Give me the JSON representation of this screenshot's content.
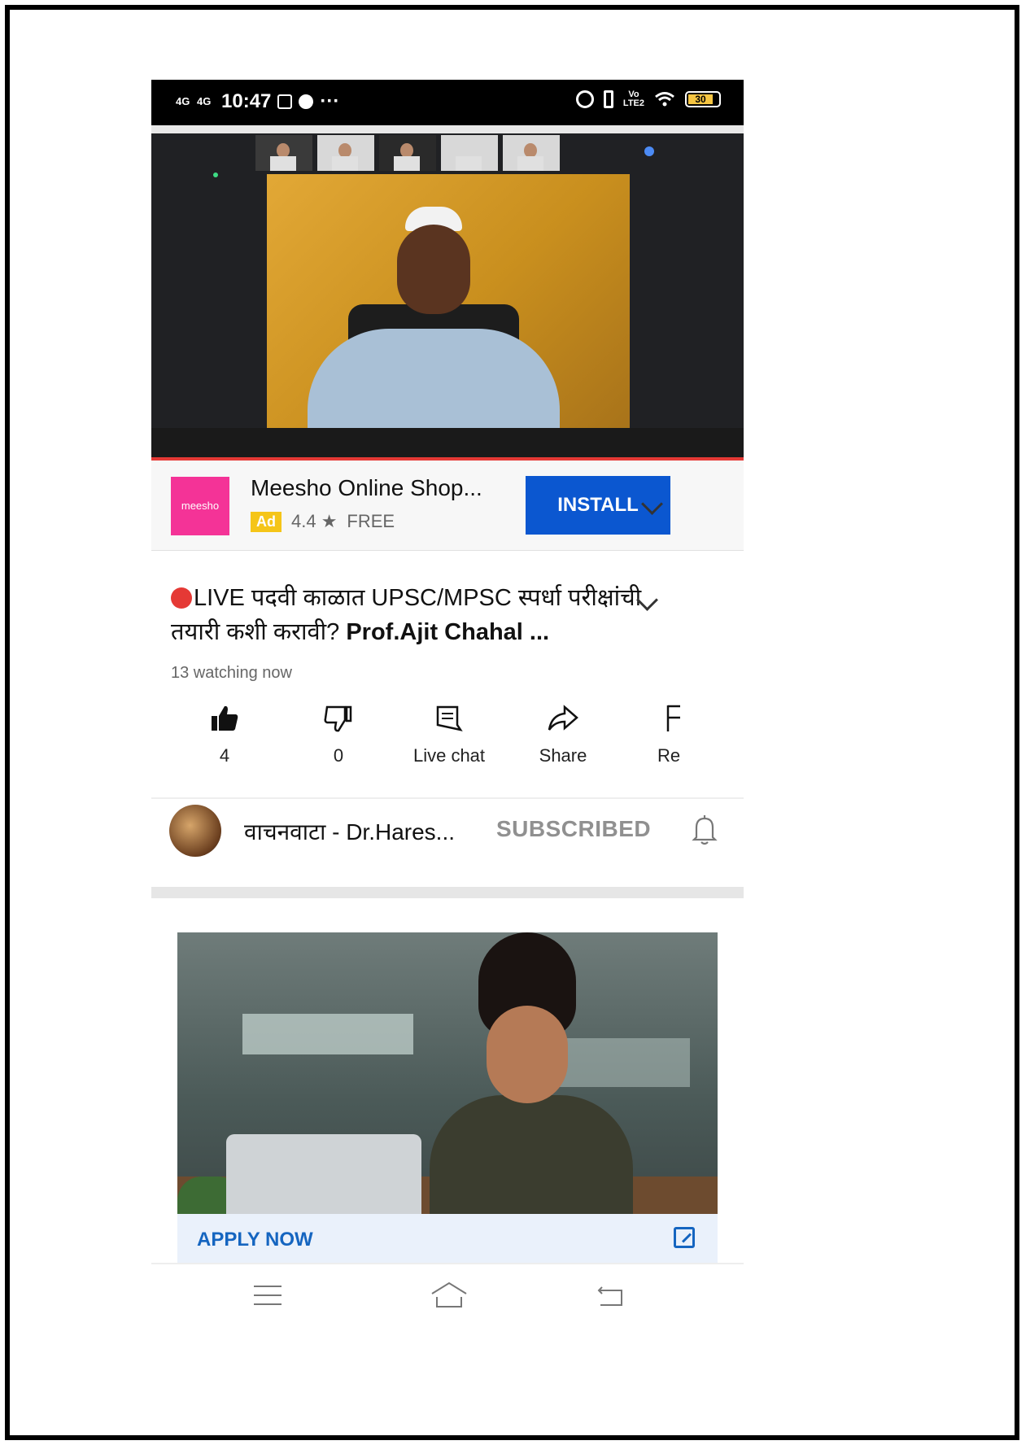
{
  "status_bar": {
    "time": "10:47",
    "net1": "4G",
    "net2": "4G",
    "volte_top": "Vo",
    "volte_bottom": "LTE2",
    "more": "···",
    "battery": "30"
  },
  "video": {
    "host_label": ""
  },
  "ad": {
    "logo_text": "meesho",
    "title": "Meesho Online Shop...",
    "badge": "Ad",
    "rating": "4.4 ★",
    "price": "FREE",
    "install_label": "INSTALL"
  },
  "video_info": {
    "title_part1": "LIVE पदवी काळात UPSC/MPSC स्पर्धा परीक्षांची तयारी कशी करावी? ",
    "title_part2": "Prof.Ajit Chahal ...",
    "watching": "13 watching now"
  },
  "actions": {
    "like_count": "4",
    "dislike_count": "0",
    "live_chat": "Live chat",
    "share": "Share",
    "report": "Re"
  },
  "channel": {
    "name": "वाचनवाटा - Dr.Hares...",
    "subscribed": "SUBSCRIBED"
  },
  "promo": {
    "apply_label": "APPLY NOW"
  },
  "colors": {
    "install_blue": "#0b57d0",
    "meesho_pink": "#f43397",
    "live_red": "#e53935",
    "apply_blue": "#1565c0"
  },
  "icons": [
    "signal-icon",
    "alarm-icon",
    "vibrate-icon",
    "wifi-icon",
    "battery-icon",
    "star-icon",
    "chevron-down-icon",
    "like-icon",
    "dislike-icon",
    "chat-icon",
    "share-icon",
    "flag-icon",
    "bell-icon",
    "external-link-icon",
    "menu-icon",
    "home-icon",
    "back-icon"
  ]
}
